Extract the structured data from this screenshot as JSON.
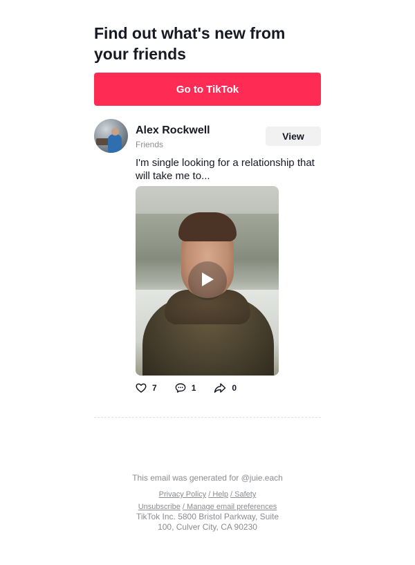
{
  "header": {
    "headline": "Find out what's new from your friends",
    "cta_label": "Go to TikTok"
  },
  "colors": {
    "brand": "#fe2c55",
    "text": "#161823",
    "muted": "#8a8b91"
  },
  "post": {
    "author_name": "Alex Rockwell",
    "relation": "Friends",
    "view_label": "View",
    "caption": "I'm single looking for a relationship that will take me to...",
    "stats": {
      "likes": "7",
      "comments": "1",
      "shares": "0"
    }
  },
  "footer": {
    "generated_for": "This email was generated for @juie.each",
    "links": {
      "privacy": "Privacy Policy",
      "help": "/ Help",
      "safety": "/ Safety",
      "unsubscribe": "Unsubscribe",
      "manage": "/ Manage email preferences"
    },
    "address": "TikTok Inc. 5800 Bristol Parkway, Suite 100, Culver City, CA 90230"
  }
}
